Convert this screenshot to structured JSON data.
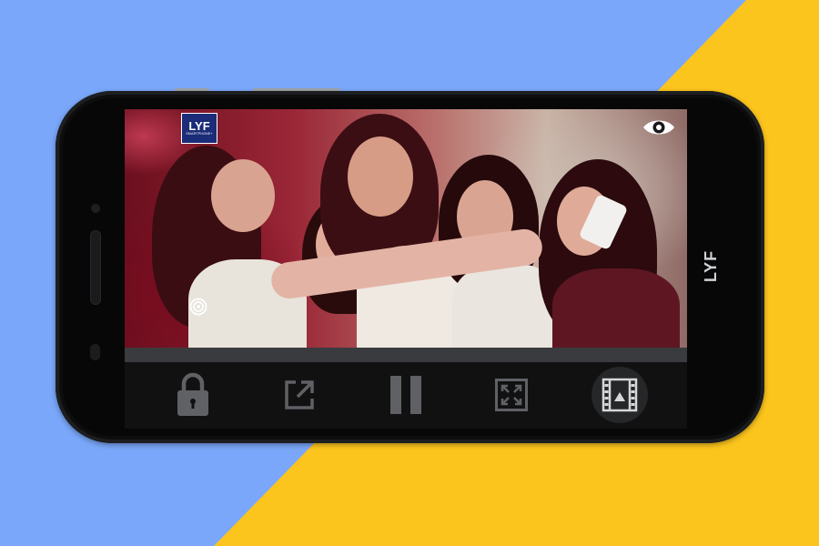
{
  "device": {
    "brand_label": "LYF",
    "colors": {
      "background_blue": "#7aa7f9",
      "background_yellow": "#fcc51d",
      "phone_body": "#0d0d0e",
      "control_icon": "#5f6165",
      "control_active_bg": "#262729"
    }
  },
  "video": {
    "watermark_title": "LYF",
    "watermark_subtitle": "SMARTPHONE+",
    "overlay_icons": [
      "eye-icon",
      "target-icon"
    ],
    "progress": 0.0
  },
  "controls": [
    {
      "icon": "lock-icon",
      "active": false
    },
    {
      "icon": "popout-icon",
      "active": false
    },
    {
      "icon": "pause-icon",
      "active": false
    },
    {
      "icon": "fullscreen-icon",
      "active": false
    },
    {
      "icon": "film-icon",
      "active": true
    }
  ]
}
